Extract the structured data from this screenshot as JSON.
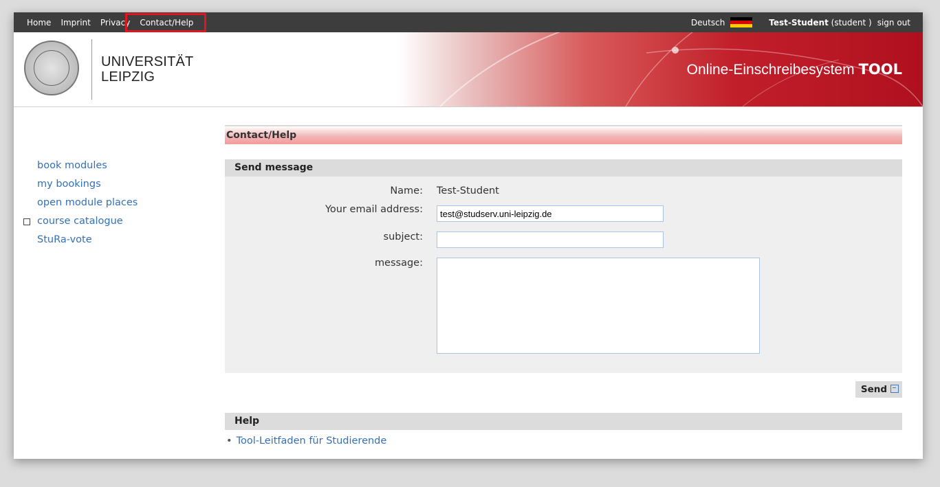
{
  "topnav": {
    "items": [
      {
        "label": "Home"
      },
      {
        "label": "Imprint"
      },
      {
        "label": "Privacy"
      },
      {
        "label": "Contact/Help",
        "active": true
      }
    ],
    "language": "Deutsch",
    "flag_colors": [
      "#000000",
      "#dd0000",
      "#ffce00"
    ],
    "user_name": "Test-Student",
    "user_role": "(student )",
    "signout": "sign out"
  },
  "banner": {
    "university_line1": "UNIVERSITÄT",
    "university_line2": "LEIPZIG",
    "system_name": "Online-Einschreibesystem",
    "system_brand": "TOOL"
  },
  "sidebar": {
    "items": [
      {
        "label": "book modules"
      },
      {
        "label": "my bookings"
      },
      {
        "label": "open module places"
      },
      {
        "label": "course catalogue",
        "icon": "external-box-icon"
      },
      {
        "label": "StuRa-vote"
      }
    ]
  },
  "main": {
    "page_title": "Contact/Help",
    "send_section": {
      "title": "Send message",
      "name_label": "Name:",
      "name_value": "Test-Student",
      "email_label": "Your email address:",
      "email_value": "test@studserv.uni-leipzig.de",
      "subject_label": "subject:",
      "subject_value": "",
      "message_label": "message:",
      "message_value": ""
    },
    "send_button": "Send",
    "help_section": {
      "title": "Help",
      "link": "Tool-Leitfaden für Studierende"
    }
  },
  "colors": {
    "accent_red": "#c11f2a",
    "link_blue": "#3470b8",
    "highlight": "#e0161e"
  }
}
